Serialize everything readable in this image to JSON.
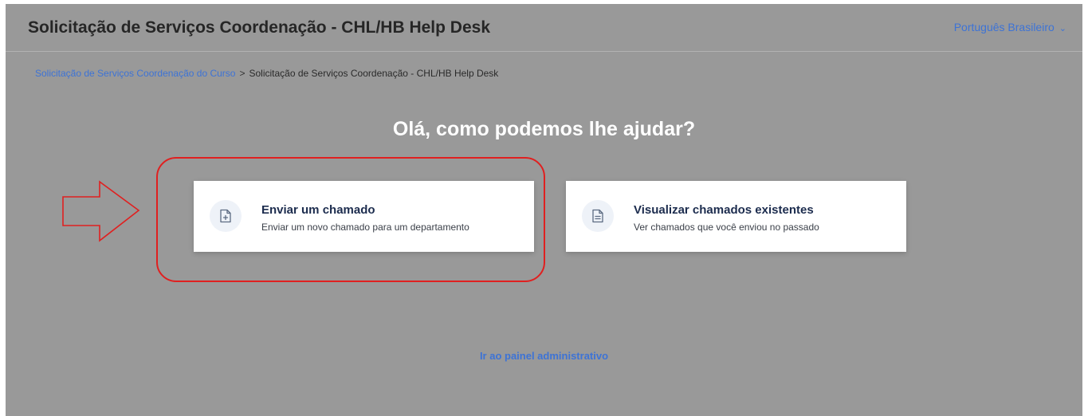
{
  "header": {
    "title": "Solicitação de Serviços Coordenação - CHL/HB Help Desk",
    "language": "Português Brasileiro"
  },
  "breadcrumb": {
    "parent": "Solicitação de Serviços Coordenação do Curso",
    "separator": ">",
    "current": "Solicitação de Serviços Coordenação - CHL/HB Help Desk"
  },
  "main": {
    "greeting": "Olá, como podemos lhe ajudar?",
    "cards": [
      {
        "title": "Enviar um chamado",
        "description": "Enviar um novo chamado para um departamento",
        "icon": "document-plus-icon"
      },
      {
        "title": "Visualizar chamados existentes",
        "description": "Ver chamados que você enviou no passado",
        "icon": "document-lines-icon"
      }
    ],
    "admin_link": "Ir ao painel administrativo"
  },
  "colors": {
    "background": "#999999",
    "link": "#3d73d6",
    "annotation": "#e02020"
  }
}
